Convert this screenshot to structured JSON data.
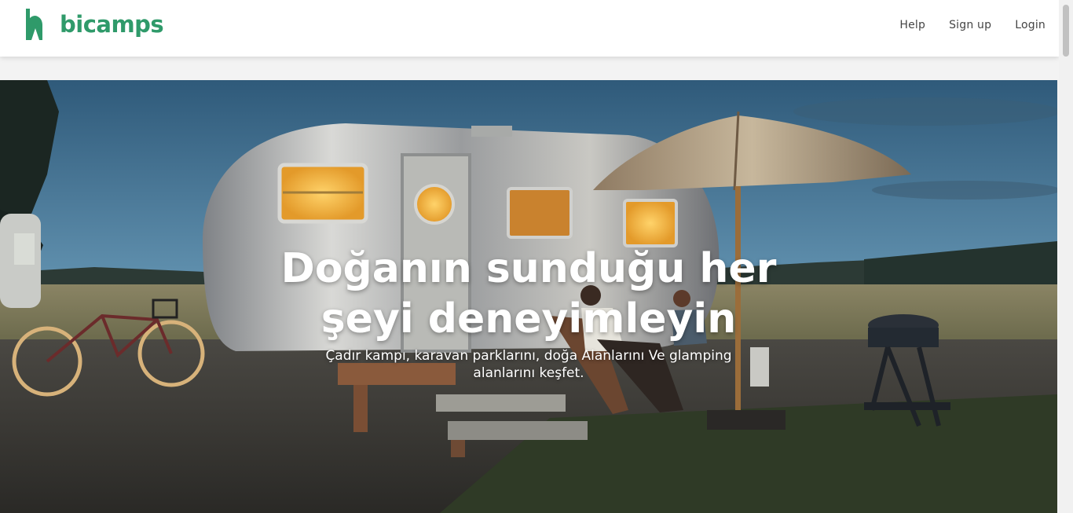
{
  "brand": {
    "name": "bicamps",
    "color": "#2f9a6a",
    "logo_icon": "tent-h-logo-icon"
  },
  "nav": {
    "help_label": "Help",
    "signup_label": "Sign up",
    "login_label": "Login"
  },
  "hero": {
    "title_line1": "Doğanın sunduğu her",
    "title_line2": "şeyi deneyimleyin",
    "subtitle_line1": "Çadır kampı, karavan parklarını, doğa Alanlarını Ve glamping",
    "subtitle_line2": "alanlarını keşfet.",
    "image": "camper-trailer-at-dusk-photo"
  }
}
